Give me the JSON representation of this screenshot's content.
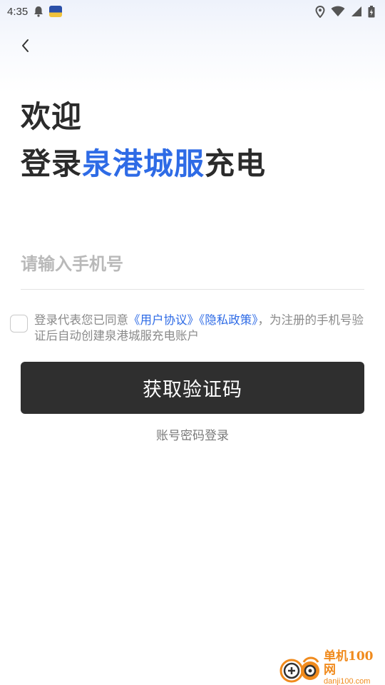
{
  "status_bar": {
    "time": "4:35",
    "icons": [
      "bell-icon",
      "app-notif-icon",
      "location-icon",
      "wifi-icon",
      "signal-icon",
      "battery-icon"
    ]
  },
  "header": {
    "back_icon": "chevron-left-icon"
  },
  "title": {
    "welcome": "欢迎",
    "login_prefix": "登录",
    "brand": "泉港城服",
    "login_suffix": "充电"
  },
  "phone": {
    "placeholder": "请输入手机号",
    "value": ""
  },
  "agreement": {
    "checked": false,
    "text_before": "登录代表您已同意",
    "user_agreement": "《用户协议》",
    "privacy_policy": "《隐私政策》",
    "text_after": "，为注册的手机号验证后自动创建泉港城服充电账户"
  },
  "actions": {
    "get_code": "获取验证码",
    "account_login": "账号密码登录"
  },
  "watermark": {
    "title": "单机100网",
    "url": "danji100.com"
  },
  "colors": {
    "brand": "#2e6be6",
    "button_bg": "#2f2f2f",
    "watermark": "#f08a1c"
  }
}
